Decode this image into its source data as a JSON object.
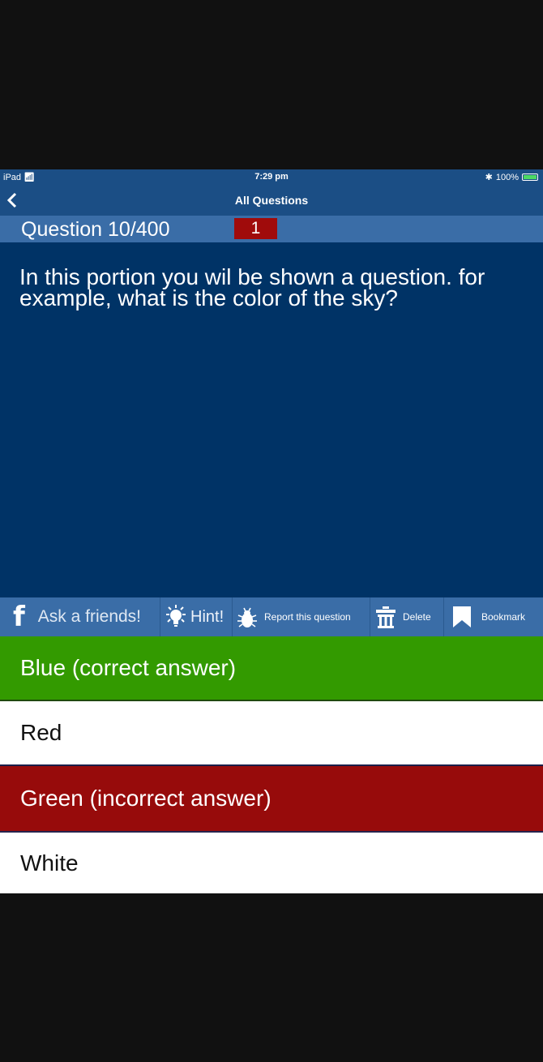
{
  "status_bar": {
    "device": "iPad",
    "time": "7:29 pm",
    "battery": "100%"
  },
  "nav": {
    "back_glyph": "‹",
    "title": "All Questions"
  },
  "question": {
    "counter": "Question 10/400",
    "badge": "1",
    "text": "In this portion you wil be shown a question. for example, what is the color of the sky?"
  },
  "toolbar": {
    "ask_label": "Ask a friends!",
    "hint_label": "Hint!",
    "report_label": "Report this question",
    "delete_label": "Delete",
    "bookmark_label": "Bookmark"
  },
  "answers": [
    {
      "label": "Blue (correct answer)",
      "state": "correct"
    },
    {
      "label": "Red",
      "state": "neutral"
    },
    {
      "label": "Green (incorrect answer)",
      "state": "incorrect"
    },
    {
      "label": "White",
      "state": "neutral"
    }
  ],
  "colors": {
    "nav_bg": "#1b4e85",
    "bar_bg": "#3a6da7",
    "question_bg": "#003366",
    "correct": "#339a00",
    "incorrect": "#970b0b",
    "badge": "#a00b0b"
  }
}
